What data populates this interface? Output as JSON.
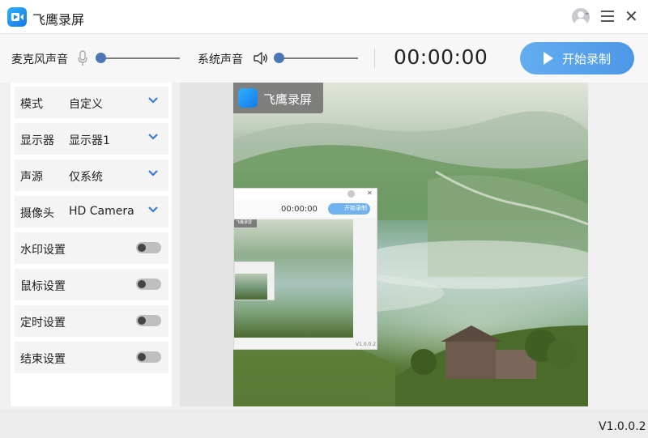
{
  "titlebar": {
    "app_name": "飞鹰录屏",
    "icons": [
      "app-logo-icon",
      "avatar-icon",
      "menu-icon",
      "close-icon"
    ]
  },
  "controls": {
    "mic_label": "麦克风声音",
    "mic_volume": 0,
    "system_label": "系统声音",
    "system_volume": 0,
    "timer": "00:00:00",
    "record_label": "开始录制"
  },
  "settings": {
    "rows": [
      {
        "name": "模式",
        "value": "自定义",
        "kind": "select"
      },
      {
        "name": "显示器",
        "value": "显示器1",
        "kind": "select"
      },
      {
        "name": "声源",
        "value": "仅系统",
        "kind": "select"
      },
      {
        "name": "摄像头",
        "value": "HD Camera",
        "kind": "select"
      },
      {
        "name": "水印设置",
        "enabled": false,
        "kind": "toggle"
      },
      {
        "name": "鼠标设置",
        "enabled": false,
        "kind": "toggle"
      },
      {
        "name": "定时设置",
        "enabled": false,
        "kind": "toggle"
      },
      {
        "name": "结束设置",
        "enabled": false,
        "kind": "toggle"
      }
    ]
  },
  "preview": {
    "watermark_text": "飞鹰录屏",
    "nested_timer": "00:00:00",
    "nested_record_label": "开始录制",
    "nested_watermark": "飞鹰录屏",
    "nested_version": "V1.0.0.2"
  },
  "footer": {
    "version": "V1.0.0.2"
  },
  "colors": {
    "accent": "#4c98e6",
    "slider_thumb": "#4b78b4",
    "chevron": "#3b7bd8"
  }
}
